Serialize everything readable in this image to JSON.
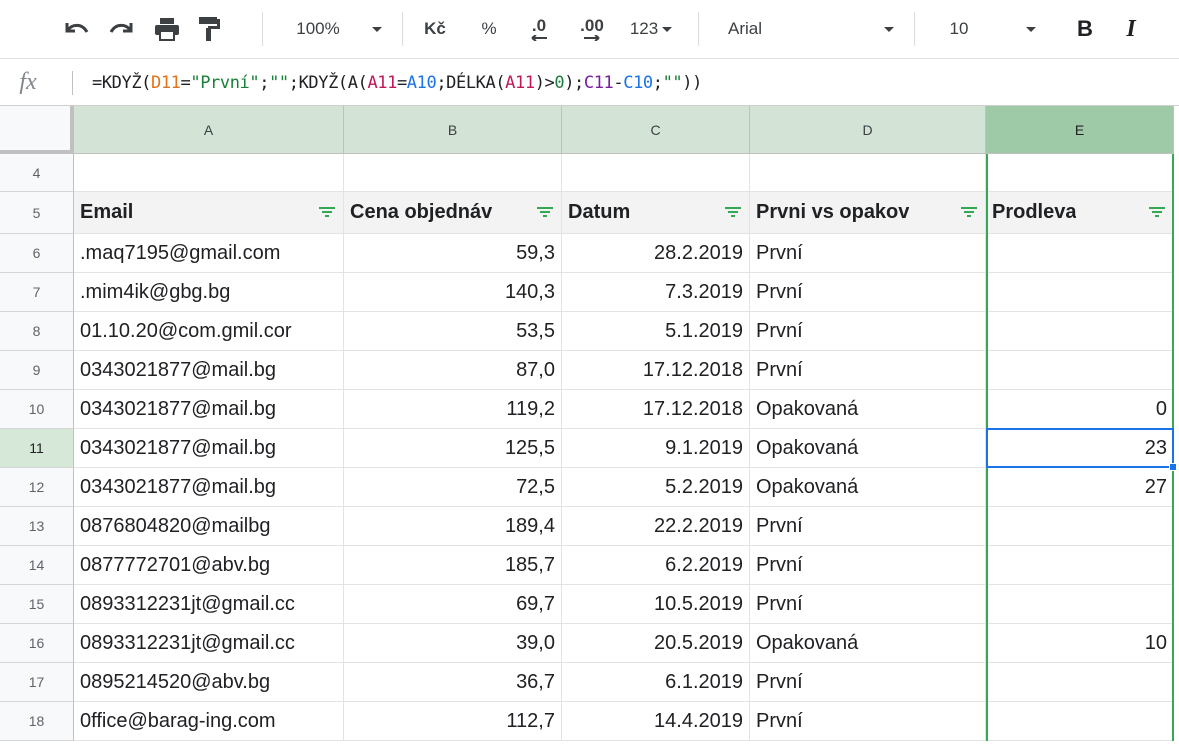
{
  "toolbar": {
    "zoom": "100%",
    "currency": "Kč",
    "percent": "%",
    "decrease_decimals": ".0",
    "increase_decimals": ".00",
    "number_format": "123",
    "font": "Arial",
    "font_size": "10",
    "bold": "B",
    "italic": "I",
    "icons": [
      "undo-icon",
      "redo-icon",
      "print-icon",
      "paint-format-icon"
    ]
  },
  "formula_bar": {
    "fx": "fx",
    "parts": [
      {
        "text": "=KDYŽ(",
        "kind": "plain"
      },
      {
        "text": "D11",
        "kind": "ref1"
      },
      {
        "text": "=",
        "kind": "plain"
      },
      {
        "text": "\"První\"",
        "kind": "str"
      },
      {
        "text": ";",
        "kind": "plain"
      },
      {
        "text": "\"\"",
        "kind": "str"
      },
      {
        "text": ";KDYŽ(A(",
        "kind": "plain"
      },
      {
        "text": "A11",
        "kind": "ref2"
      },
      {
        "text": "=",
        "kind": "plain"
      },
      {
        "text": "A10",
        "kind": "ref3"
      },
      {
        "text": ";DÉLKA(",
        "kind": "plain"
      },
      {
        "text": "A11",
        "kind": "ref2"
      },
      {
        "text": ")>",
        "kind": "plain"
      },
      {
        "text": "0",
        "kind": "num"
      },
      {
        "text": ");",
        "kind": "plain"
      },
      {
        "text": "C11",
        "kind": "ref4"
      },
      {
        "text": "-",
        "kind": "plain"
      },
      {
        "text": "C10",
        "kind": "ref3"
      },
      {
        "text": ";",
        "kind": "plain"
      },
      {
        "text": "\"\"",
        "kind": "str"
      },
      {
        "text": "))",
        "kind": "plain"
      }
    ]
  },
  "columns": [
    "A",
    "B",
    "C",
    "D",
    "E"
  ],
  "header_row": {
    "row_number": "5",
    "labels": [
      "Email",
      "Cena objednáv",
      "Datum",
      "Prvni vs opakov",
      "Prodleva"
    ]
  },
  "empty_row_number": "4",
  "rows": [
    {
      "n": "6",
      "email": ".maq7195@gmail.com",
      "price": "59,3",
      "date": "28.2.2019",
      "type": "První",
      "delay": ""
    },
    {
      "n": "7",
      "email": ".mim4ik@gbg.bg",
      "price": "140,3",
      "date": "7.3.2019",
      "type": "První",
      "delay": ""
    },
    {
      "n": "8",
      "email": "01.10.20@com.gmil.cor",
      "price": "53,5",
      "date": "5.1.2019",
      "type": "První",
      "delay": ""
    },
    {
      "n": "9",
      "email": "0343021877@mail.bg",
      "price": "87,0",
      "date": "17.12.2018",
      "type": "První",
      "delay": ""
    },
    {
      "n": "10",
      "email": "0343021877@mail.bg",
      "price": "119,2",
      "date": "17.12.2018",
      "type": "Opakovaná",
      "delay": "0"
    },
    {
      "n": "11",
      "email": "0343021877@mail.bg",
      "price": "125,5",
      "date": "9.1.2019",
      "type": "Opakovaná",
      "delay": "23"
    },
    {
      "n": "12",
      "email": "0343021877@mail.bg",
      "price": "72,5",
      "date": "5.2.2019",
      "type": "Opakovaná",
      "delay": "27"
    },
    {
      "n": "13",
      "email": "0876804820@mailbg",
      "price": "189,4",
      "date": "22.2.2019",
      "type": "První",
      "delay": ""
    },
    {
      "n": "14",
      "email": "0877772701@abv.bg",
      "price": "185,7",
      "date": "6.2.2019",
      "type": "První",
      "delay": ""
    },
    {
      "n": "15",
      "email": "0893312231jt@gmail.cc",
      "price": "69,7",
      "date": "10.5.2019",
      "type": "První",
      "delay": ""
    },
    {
      "n": "16",
      "email": "0893312231jt@gmail.cc",
      "price": "39,0",
      "date": "20.5.2019",
      "type": "Opakovaná",
      "delay": "10"
    },
    {
      "n": "17",
      "email": "0895214520@abv.bg",
      "price": "36,7",
      "date": "6.1.2019",
      "type": "První",
      "delay": ""
    },
    {
      "n": "18",
      "email": "0ffice@barag-ing.com",
      "price": "112,7",
      "date": "14.4.2019",
      "type": "První",
      "delay": ""
    }
  ],
  "selection": {
    "column": "E",
    "row": "11"
  },
  "colors": {
    "selection_blue": "#1a73e8",
    "selected_column_green": "#34a853",
    "header_bg": "#f8f9fa"
  }
}
